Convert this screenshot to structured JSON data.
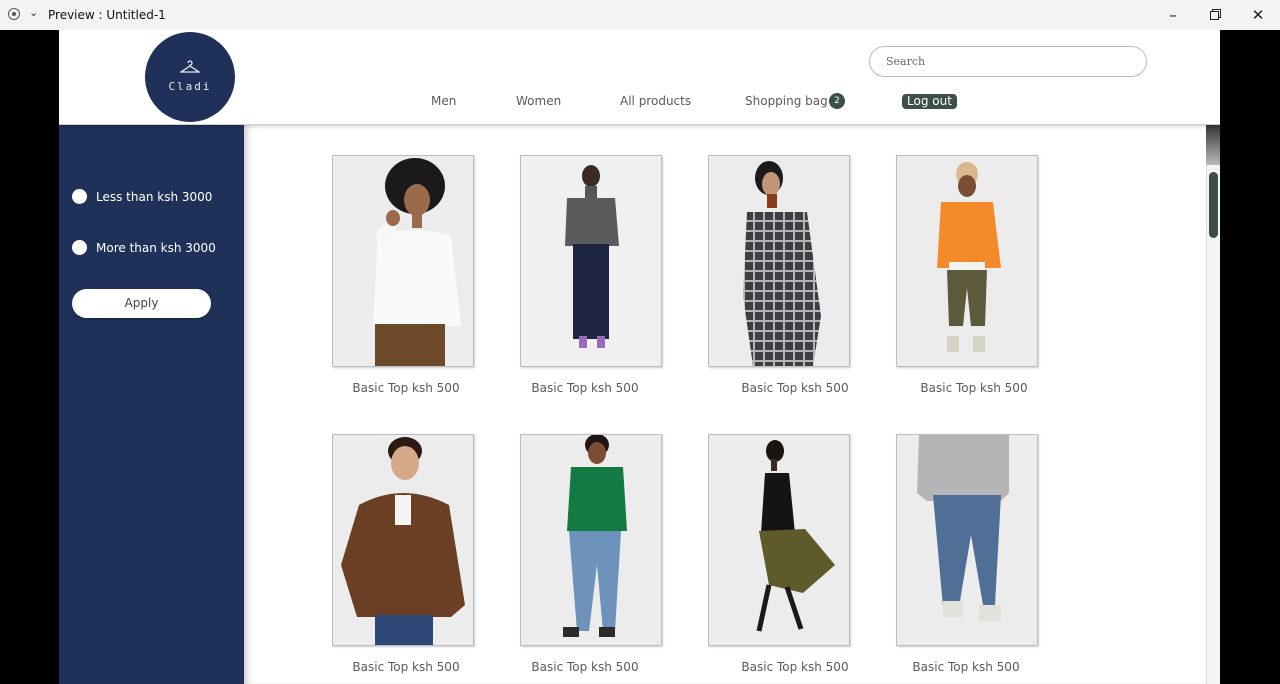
{
  "window": {
    "title": "Preview : Untitled-1"
  },
  "header": {
    "logo_text": "Cladi",
    "search_placeholder": "Search",
    "nav": [
      "Men",
      "Women",
      "All products",
      "Shopping bag"
    ],
    "bag_count": "2",
    "logout_label": "Log out"
  },
  "sidebar": {
    "filters": [
      "Less than ksh 3000",
      "More than ksh 3000"
    ],
    "apply_label": "Apply"
  },
  "products": [
    {
      "caption": "Basic Top ksh 500"
    },
    {
      "caption": "Basic Top ksh 500"
    },
    {
      "caption": "Basic Top ksh 500"
    },
    {
      "caption": "Basic Top ksh 500"
    },
    {
      "caption": "Basic Top ksh 500"
    },
    {
      "caption": "Basic Top ksh 500"
    },
    {
      "caption": "Basic Top ksh 500"
    },
    {
      "caption": "Basic Top ksh 500"
    }
  ],
  "colors": {
    "brand_navy": "#1f3158",
    "accent_dark_green": "#3d4f4a"
  }
}
